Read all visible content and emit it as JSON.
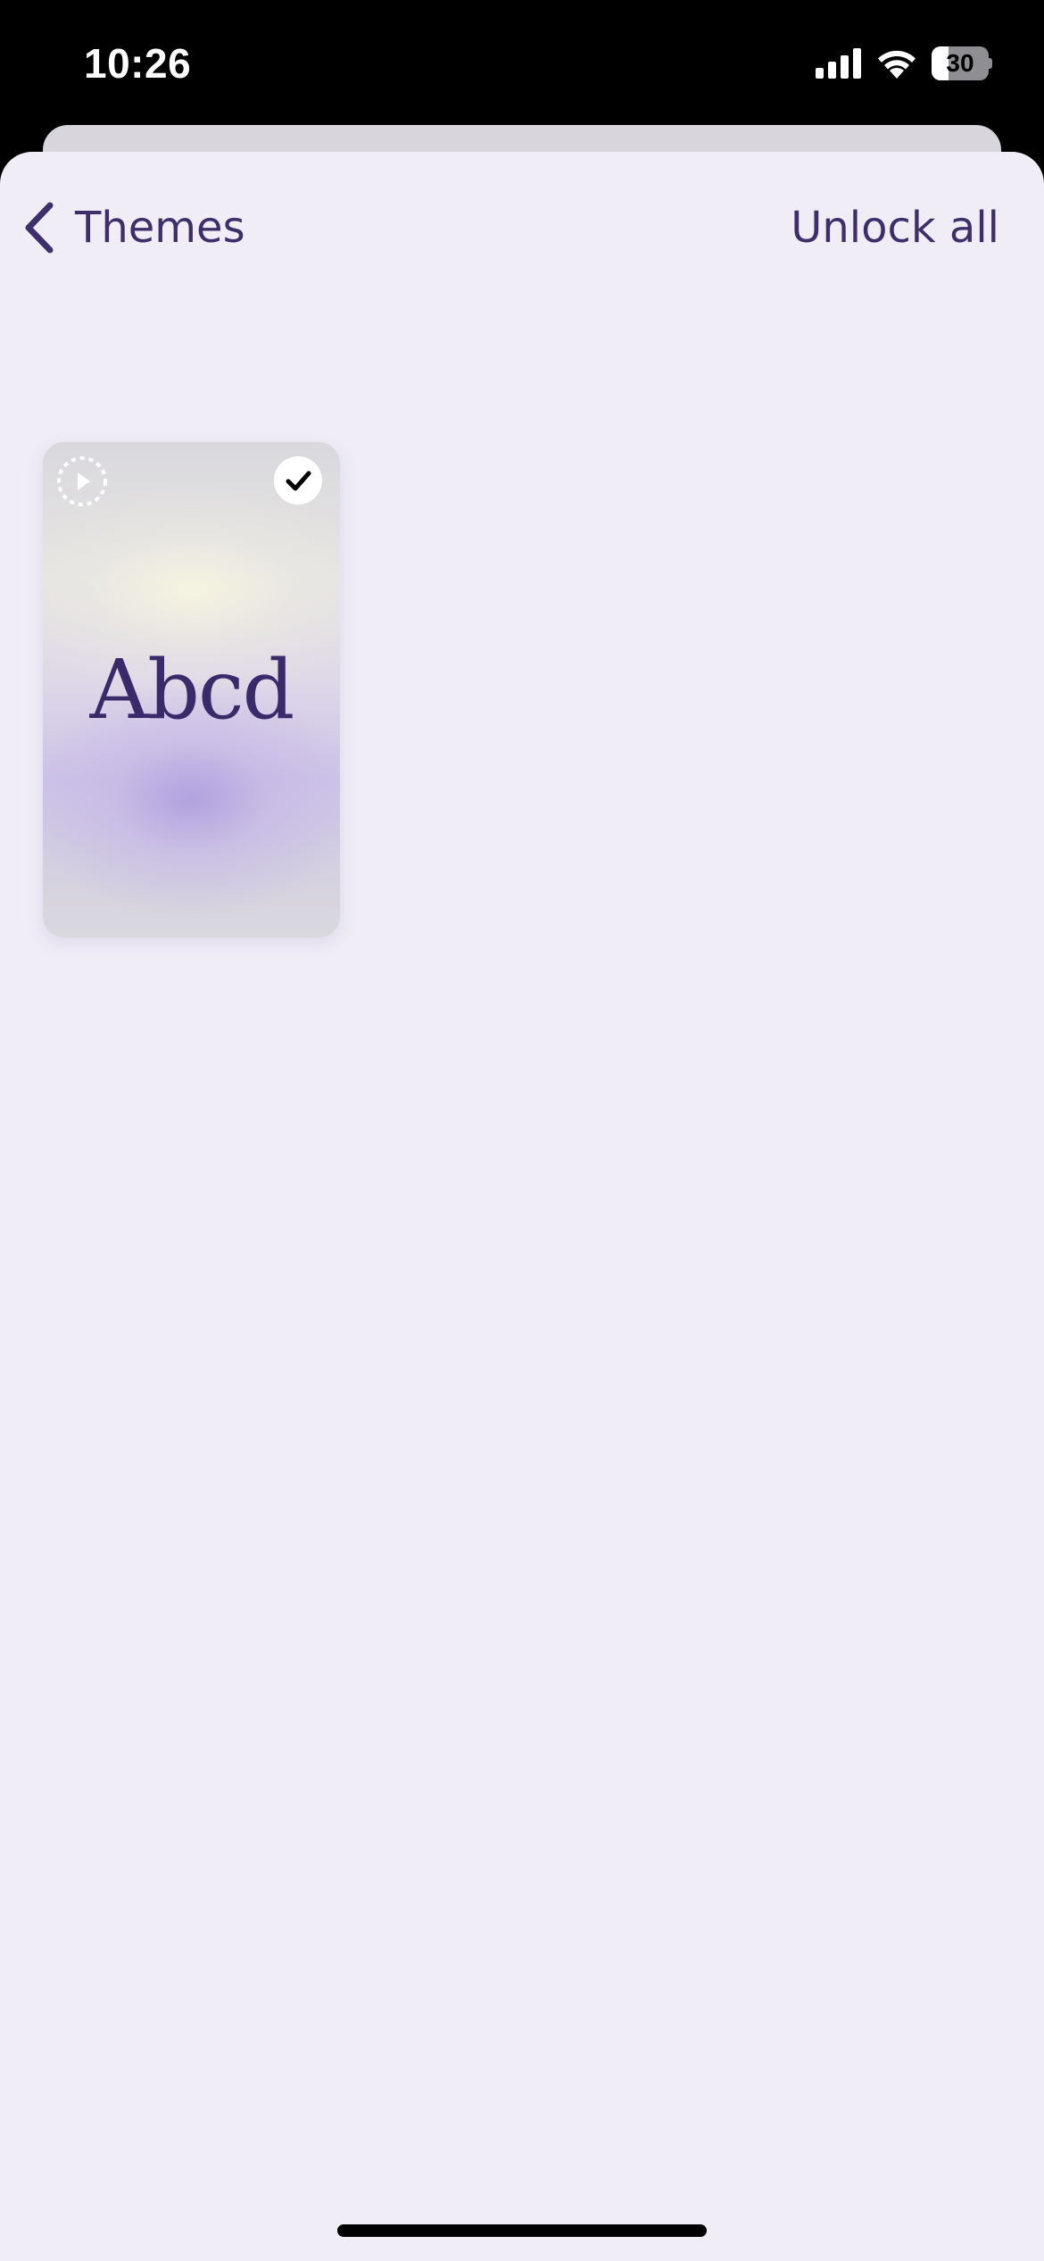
{
  "status_bar": {
    "time": "10:26",
    "battery_level": "30",
    "icons": [
      "cellular-signal-icon",
      "wifi-icon",
      "battery-icon"
    ]
  },
  "nav": {
    "back_icon": "chevron-left-icon",
    "title": "Themes",
    "action_label": "Unlock all"
  },
  "themes": [
    {
      "preview_text": "Abcd",
      "selected": true,
      "badges": [
        "play-icon",
        "checkmark-icon"
      ]
    }
  ],
  "colors": {
    "accent": "#3e2f6a",
    "background": "#f0edf7",
    "status_bar": "#000000"
  }
}
